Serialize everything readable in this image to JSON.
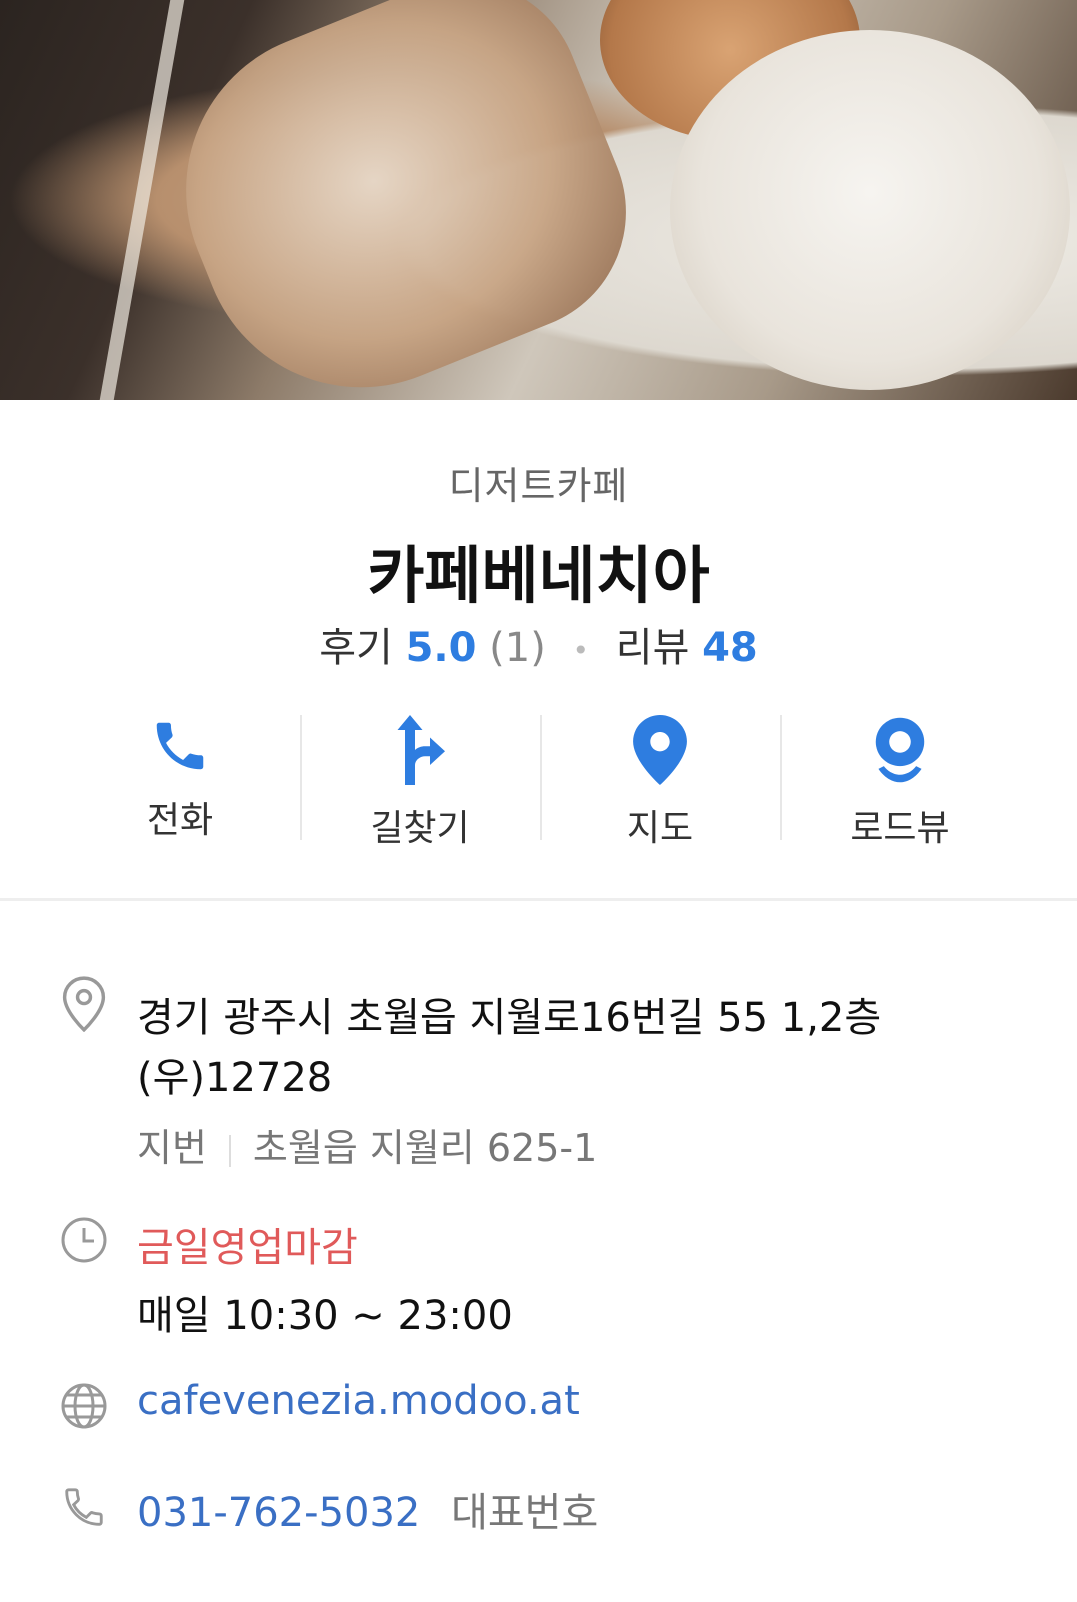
{
  "place": {
    "category": "디저트카페",
    "name": "카페베네치아",
    "review_label": "후기",
    "review_score": "5.0",
    "review_count": "(1)",
    "blog_label": "리뷰",
    "blog_count": "48"
  },
  "actions": [
    {
      "label": "전화",
      "icon": "phone-icon"
    },
    {
      "label": "길찾기",
      "icon": "directions-icon"
    },
    {
      "label": "지도",
      "icon": "map-pin-icon"
    },
    {
      "label": "로드뷰",
      "icon": "roadview-icon"
    }
  ],
  "info": {
    "address_line1": "경기 광주시 초월읍 지월로16번길 55 1,2층",
    "address_line2": "(우)12728",
    "jibun_label": "지번",
    "jibun_value": "초월읍 지월리 625-1",
    "status": "금일영업마감",
    "hours": "매일 10:30 ~ 23:00",
    "website": "cafevenezia.modoo.at",
    "phone": "031-762-5032",
    "phone_note": "대표번호"
  },
  "colors": {
    "accent_blue": "#2e7de0",
    "status_red": "#e05a5a",
    "link_blue": "#3a6fc4"
  }
}
